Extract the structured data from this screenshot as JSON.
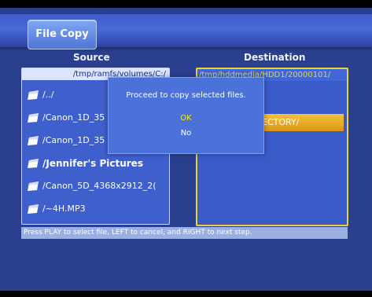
{
  "header": {
    "title": "File Copy"
  },
  "source": {
    "heading": "Source",
    "path": "/tmp/ramfs/volumes/C:/",
    "items": [
      {
        "label": "/../",
        "icon": "folder-icon",
        "style": "normal"
      },
      {
        "label": "/Canon_1D_35",
        "icon": "folder-icon",
        "style": "normal"
      },
      {
        "label": "/Canon_1D_35",
        "icon": "folder-icon",
        "style": "normal"
      },
      {
        "label": "/Jennifer's Pictures",
        "icon": "folder-icon",
        "style": "big"
      },
      {
        "label": "/Canon_5D_4368x2912_2(",
        "icon": "folder-icon",
        "style": "normal"
      },
      {
        "label": "/~4H.MP3",
        "icon": "file-icon",
        "style": "normal"
      }
    ]
  },
  "destination": {
    "heading": "Destination",
    "path": "/tmp/hddmedia/HDD1/20000101/",
    "selected_dir_label": "ECTORY/"
  },
  "dialog": {
    "message": "Proceed to copy selected files.",
    "ok_label": "OK",
    "no_label": "No"
  },
  "hint": "Press PLAY to select file, LEFT to cancel, and RIGHT to next step.",
  "colors": {
    "background": "#2b3f8f",
    "accent_yellow": "#e8d33a",
    "highlight_orange": "#e3a726",
    "dialog_blue": "#4b72d8"
  }
}
